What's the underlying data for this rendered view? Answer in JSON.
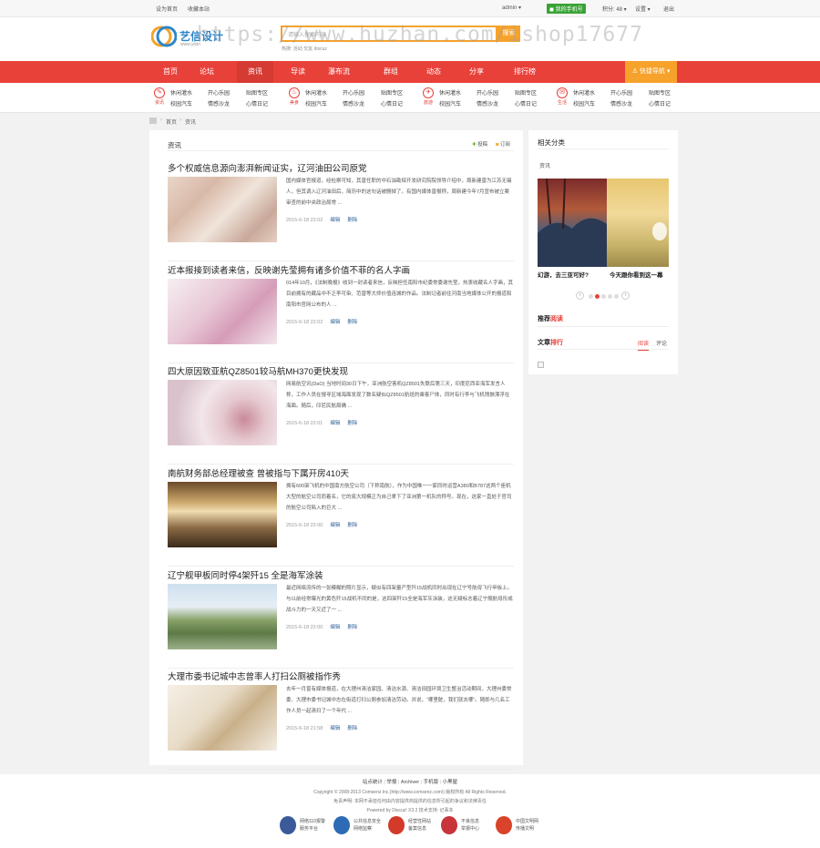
{
  "topbar": {
    "set_home": "设为首页",
    "favorite": "收藏本站",
    "user": "admin",
    "phone_bind": "我的手机号",
    "points": "积分: 48",
    "settings": "设置",
    "logout": "退出"
  },
  "header": {
    "logo_text": "艺信设计",
    "logo_sub": "www.yixin",
    "search_placeholder": "请输入搜索内容",
    "hot_label": "热搜:",
    "hot_terms": "活动  交友  discuz",
    "search_button": "搜索",
    "watermark": "https://www.huzhan.com/ishop17677"
  },
  "nav": {
    "items": [
      "首页",
      "论坛",
      "资讯",
      "导读",
      "瀑布流",
      "群组",
      "动态",
      "分享",
      "排行榜"
    ],
    "active_index": 2,
    "quick_nav": "快捷导航"
  },
  "subnav": {
    "groups": [
      {
        "icon": "资讯",
        "links": [
          "休闲灌水",
          "开心乐园",
          "贴图专区",
          "校园汽车",
          "情感沙龙",
          "心情日记"
        ]
      },
      {
        "icon": "美食",
        "links": [
          "休闲灌水",
          "开心乐园",
          "贴图专区",
          "校园汽车",
          "情感沙龙",
          "心情日记"
        ]
      },
      {
        "icon": "旅游",
        "links": [
          "休闲灌水",
          "开心乐园",
          "贴图专区",
          "校园汽车",
          "情感沙龙",
          "心情日记"
        ]
      },
      {
        "icon": "生活",
        "links": [
          "休闲灌水",
          "开心乐园",
          "贴图专区",
          "校园汽车",
          "情感沙龙",
          "心情日记"
        ]
      }
    ]
  },
  "breadcrumb": {
    "home": "首页",
    "current": "资讯"
  },
  "main": {
    "title": "资讯",
    "publish": "投稿",
    "subscribe": "订阅",
    "edit_label": "编辑",
    "delete_label": "删除",
    "articles": [
      {
        "title": "多个权威信息源向澎湃新闻证实，辽河油田公司原党",
        "summary": "国内媒体官报道，经检察可知，其曾任职的中石油勘探开发研究院院领导介绍中，周新建曾为江苏无锡人，但其调入辽河油田后，简历中的这句话被删掉了。有国内媒体曾报称，周新建今年7月宣布被立案审查的前中央政治局常 ...",
        "date": "2015-6-18 22:02",
        "thumb": "photos-wall"
      },
      {
        "title": "近本报接到读者来信，反映谢先莹拥有诸多价值不菲的名人字画",
        "summary": "014年10月，《法制晚报》收到一封读者来信，反映担任南阳市纪委常委谢先莹，热衷收藏名人字画，其目前拥有的藏品中不乏李可染、范曾等大师价值连城的作品。法制记者前往河南当地媒体公开的报道和南阳市官网公布的人 ...",
        "date": "2015-6-18 22:02",
        "thumb": "flowers-pink"
      },
      {
        "title": "四大原因致亚航QZ8501较马航MH370更快发现",
        "summary": "网易航空讯(DaO) 当地时间30日下午，亚洲航空客机QZ8501失联后第三天，印度尼西亚海军发言人称，工作人员在搜寻区域海面发现了数名疑似QZ8501航班的乘客尸体，同时有行李与飞机残骸漂浮在海面。随后，印尼民航局确 ...",
        "date": "2015-6-18 22:01",
        "thumb": "rose-bokeh"
      },
      {
        "title": "南航财务部总经理被查 曾被指与下属开房410天",
        "summary": "拥有600架飞机的中国南方航空公司（下称南航），作为中国唯一一家同时运营A380和B787这两个座机大型的航空公司而着名，它的庞大规模正为自己拿下了亚洲第一机队的称号。现在，这家一直处于官司的航空公司陷入的巨大 ...",
        "date": "2015-6-18 22:00",
        "thumb": "interior-room"
      },
      {
        "title": "辽宁舰甲板同时停4架歼15 全是海军涂装",
        "summary": "最近网络流传的一张模糊的照片显示，疑似有四架量产型歼15战机同时出现在辽宁号航母飞行甲板上。与以前经常曝光的黄色歼15战机不同的是，这四架歼15全是海军灰涂装，这无疑标志着辽宁舰航母形成战斗力的一天又近了一 ...",
        "date": "2015-6-18 22:00",
        "thumb": "landscape-field"
      },
      {
        "title": "大理市委书记城中志曾率人打扫公厕被指作秀",
        "summary": "去年一月曾有媒体报道，在大理州清洁家园、清洁水源、清洁田园环境卫生整治活动期间，大理州委常委、大理市委书记城中志在街道打扫公厕参加清洁劳动。并说，“哪里脏，我们就去哪”。随即与几名工作人员一起清扫了一个年代 ...",
        "date": "2015-6-18 21:58",
        "thumb": "bright-room"
      }
    ]
  },
  "sidebar": {
    "related_title": "相关分类",
    "related_item": "资讯",
    "slides": [
      {
        "caption": "幻游，去三亚可好?"
      },
      {
        "caption": "今天跟你看到这一幕"
      }
    ],
    "slider_dots": 5,
    "slider_active": 1,
    "recommended_title_a": "推荐",
    "recommended_title_b": "阅读",
    "ranking_title_a": "文章",
    "ranking_title_b": "排行",
    "tab_read": "阅读",
    "tab_comment": "评论"
  },
  "footer": {
    "links": [
      "站点统计",
      "举报",
      "Archiver",
      "手机版",
      "小黑屋"
    ],
    "copyright": "Copyright © 2008-2013 Comsenz Inc.(http://www.comsenz.com/) 版权所有 All Rights Reserved.",
    "disclaimer": "免责声明: 本网不承担任何由内容提供商提供的信息所引起的争议和法律责任",
    "powered": "Powered by Discuz! X3.2  技术支持: 记事本",
    "badges": [
      {
        "line1": "网络110报警",
        "line2": "服务平台"
      },
      {
        "line1": "公共信息安全",
        "line2": "网络监察"
      },
      {
        "line1": "经营性网站",
        "line2": "备案信息"
      },
      {
        "line1": "不良信息",
        "line2": "举报中心"
      },
      {
        "line1": "中国文明网",
        "line2": "传播文明"
      }
    ]
  },
  "colors": {
    "nav_red": "#e8413a",
    "quick_nav_orange": "#f6a22b",
    "link_blue": "#336699"
  }
}
